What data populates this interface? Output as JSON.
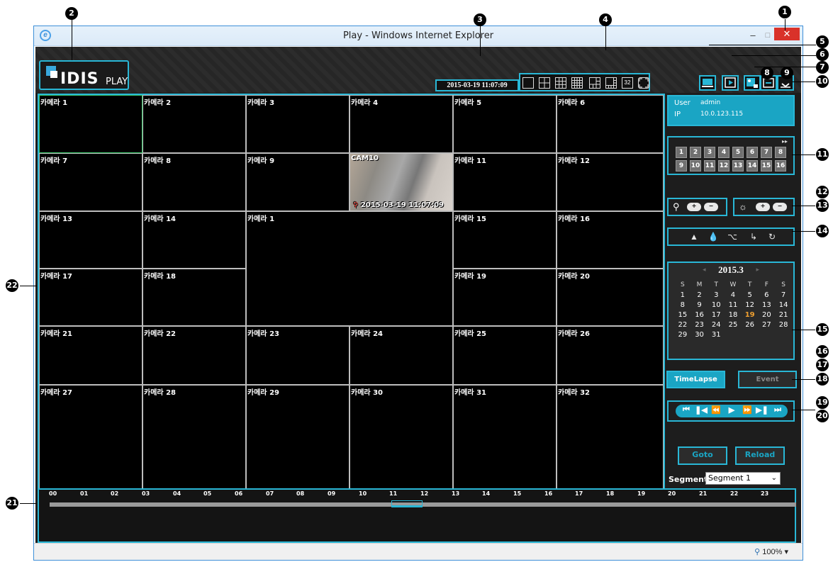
{
  "window": {
    "title": "Play - Windows Internet Explorer",
    "min": "‒",
    "max": "□",
    "close": "✕",
    "zoom": "100%",
    "zoom_arrow": "▾",
    "ie_logo": "e"
  },
  "app": {
    "logo_text": "IDIS",
    "logo_sub": "PLAY",
    "datetime": "2015-03-19 11:07:09"
  },
  "layout_buttons": [
    "1x1",
    "2x2",
    "3x3",
    "4x4",
    "1+5",
    "1+7",
    "32",
    "fullscreen"
  ],
  "layout_32_label": "32",
  "session": {
    "user_label": "User",
    "user_value": "admin",
    "ip_label": "IP",
    "ip_value": "10.0.123.115"
  },
  "cameras": {
    "c1": "카메라 1",
    "c2": "카메라 2",
    "c3": "카메라 3",
    "c4": "카메라 4",
    "c5": "카메라 5",
    "c6": "카메라 6",
    "c7": "카메라 7",
    "c8": "카메라 8",
    "c9": "카메라 9",
    "c10": "CAM10",
    "c11": "카메라 11",
    "c12": "카메라 12",
    "c13": "카메라 13",
    "c14": "카메라 14",
    "cbig": "카메라 1",
    "c15": "카메라 15",
    "c16": "카메라 16",
    "c17": "카메라 17",
    "c18": "카메라 18",
    "c19": "카메라 19",
    "c20": "카메라 20",
    "c21": "카메라 21",
    "c22": "카메라 22",
    "c23": "카메라 23",
    "c24": "카메라 24",
    "c25": "카메라 25",
    "c26": "카메라 26",
    "c27": "카메라 27",
    "c28": "카메라 28",
    "c29": "카메라 29",
    "c30": "카메라 30",
    "c31": "카메라 31",
    "c32": "카메라 32"
  },
  "cam10_time": "2015-03-19 11:07:09",
  "channels": [
    "1",
    "2",
    "3",
    "4",
    "5",
    "6",
    "7",
    "8",
    "9",
    "10",
    "11",
    "12",
    "13",
    "14",
    "15",
    "16"
  ],
  "channels_next": "▸▸",
  "zoom_ctrl": {
    "icon": "magnifier-icon",
    "plus": "+",
    "minus": "−"
  },
  "bright_ctrl": {
    "icon": "brightness-icon",
    "plus": "+",
    "minus": "−"
  },
  "adjust_icons": [
    "triangle-icon",
    "drop-icon",
    "equalizer-icon",
    "flow-icon",
    "refresh-icon"
  ],
  "calendar": {
    "title": "2015.3",
    "prev": "◂",
    "next": "▸",
    "weekdays": [
      "S",
      "M",
      "T",
      "W",
      "T",
      "F",
      "S"
    ],
    "weeks": [
      [
        "1",
        "2",
        "3",
        "4",
        "5",
        "6",
        "7"
      ],
      [
        "8",
        "9",
        "10",
        "11",
        "12",
        "13",
        "14"
      ],
      [
        "15",
        "16",
        "17",
        "18",
        "19",
        "20",
        "21"
      ],
      [
        "22",
        "23",
        "24",
        "25",
        "26",
        "27",
        "28"
      ],
      [
        "29",
        "30",
        "31",
        "",
        "",
        "",
        ""
      ]
    ],
    "today": "19"
  },
  "modes": {
    "timelapse": "TimeLapse",
    "event": "Event"
  },
  "actions": {
    "goto": "Goto",
    "reload": "Reload"
  },
  "segment": {
    "label": "Segment",
    "value": "Segment 1"
  },
  "timeline": {
    "hours": [
      "00",
      "01",
      "02",
      "03",
      "04",
      "05",
      "06",
      "07",
      "08",
      "09",
      "10",
      "11",
      "12",
      "13",
      "14",
      "15",
      "16",
      "17",
      "18",
      "19",
      "20",
      "21",
      "22",
      "23"
    ]
  },
  "callouts": [
    "1",
    "2",
    "3",
    "4",
    "5",
    "6",
    "7",
    "8",
    "9",
    "10",
    "11",
    "12",
    "13",
    "14",
    "15",
    "16",
    "17",
    "18",
    "19",
    "20",
    "21",
    "22"
  ],
  "colors": {
    "accent": "#29b7d6",
    "panel": "#1aa5c4",
    "today": "#f0a030",
    "close": "#d9322a"
  }
}
